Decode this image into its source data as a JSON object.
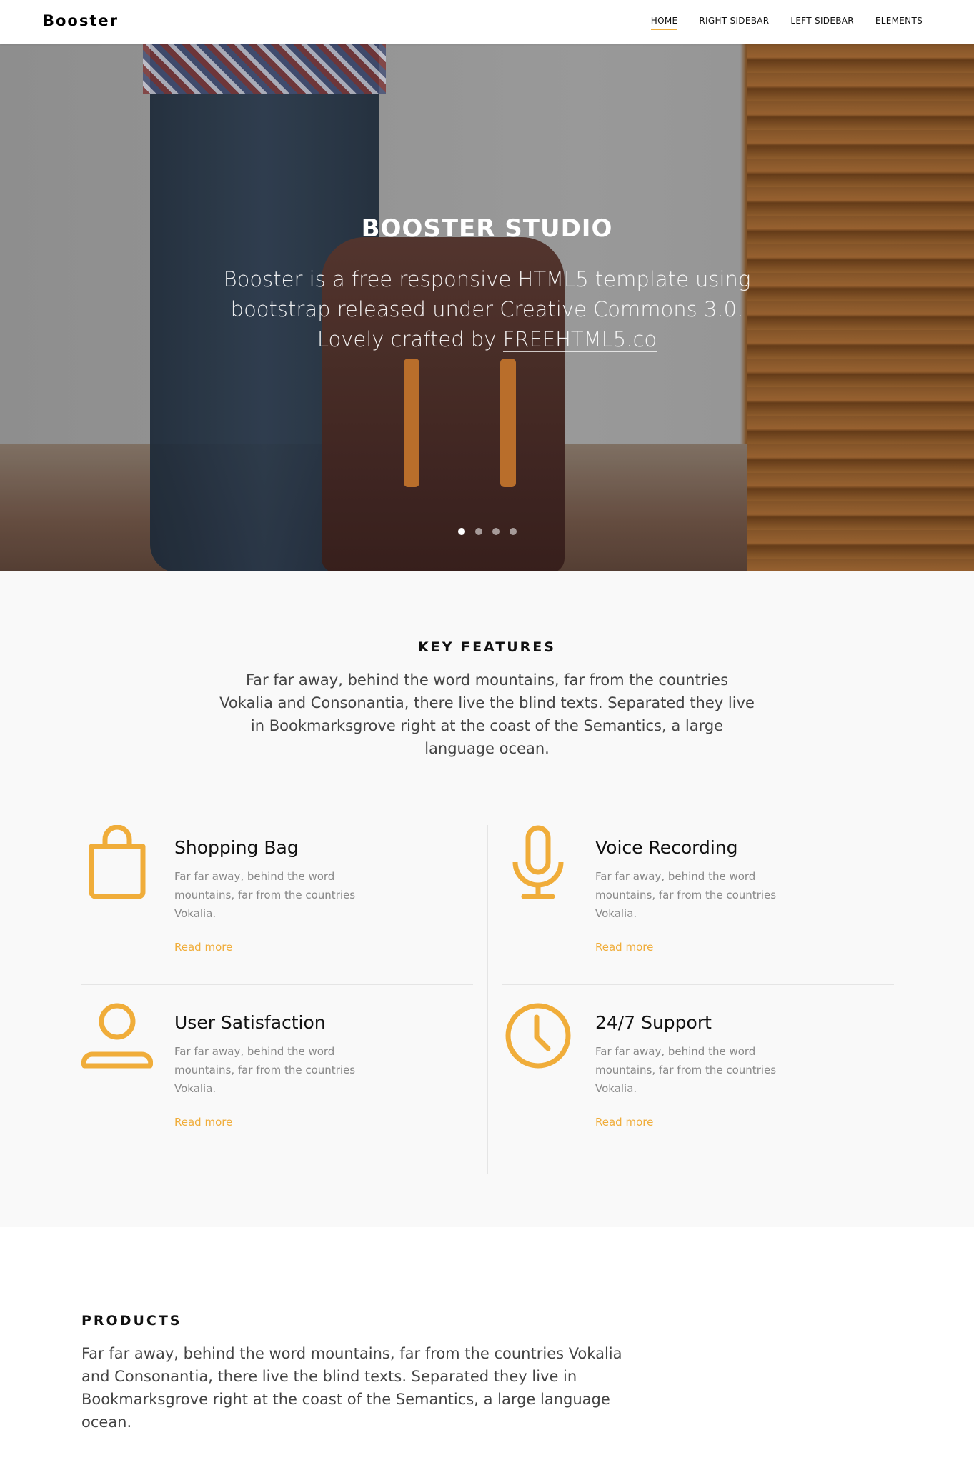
{
  "brand": {
    "name": "Booster"
  },
  "nav": {
    "items": [
      {
        "label": "HOME",
        "active": true
      },
      {
        "label": "RIGHT SIDEBAR",
        "active": false
      },
      {
        "label": "LEFT SIDEBAR",
        "active": false
      },
      {
        "label": "ELEMENTS",
        "active": false
      }
    ]
  },
  "hero": {
    "title": "BOOSTER STUDIO",
    "text": "Booster is a free responsive HTML5 template using bootstrap released under Creative Commons 3.0. Lovely crafted by",
    "link_text": "FREEHTML5.co",
    "slides": 4,
    "active_slide": 1
  },
  "features": {
    "title": "KEY FEATURES",
    "intro": "Far far away, behind the word mountains, far from the countries Vokalia and Consonantia, there live the blind texts. Separated they live in Bookmarksgrove right at the coast of the Semantics, a large language ocean.",
    "accent_color": "#f0ad3a",
    "items": [
      {
        "icon": "shopping-bag-icon",
        "title": "Shopping Bag",
        "text": "Far far away, behind the word mountains, far from the countries Vokalia.",
        "more": "Read more"
      },
      {
        "icon": "microphone-icon",
        "title": "Voice Recording",
        "text": "Far far away, behind the word mountains, far from the countries Vokalia.",
        "more": "Read more"
      },
      {
        "icon": "user-icon",
        "title": "User Satisfaction",
        "text": "Far far away, behind the word mountains, far from the countries Vokalia.",
        "more": "Read more"
      },
      {
        "icon": "clock-icon",
        "title": "24/7 Support",
        "text": "Far far away, behind the word mountains, far from the countries Vokalia.",
        "more": "Read more"
      }
    ]
  },
  "products": {
    "title": "PRODUCTS",
    "intro": "Far far away, behind the word mountains, far from the countries Vokalia and Consonantia, there live the blind texts. Separated they live in Bookmarksgrove right at the coast of the Semantics, a large language ocean."
  }
}
